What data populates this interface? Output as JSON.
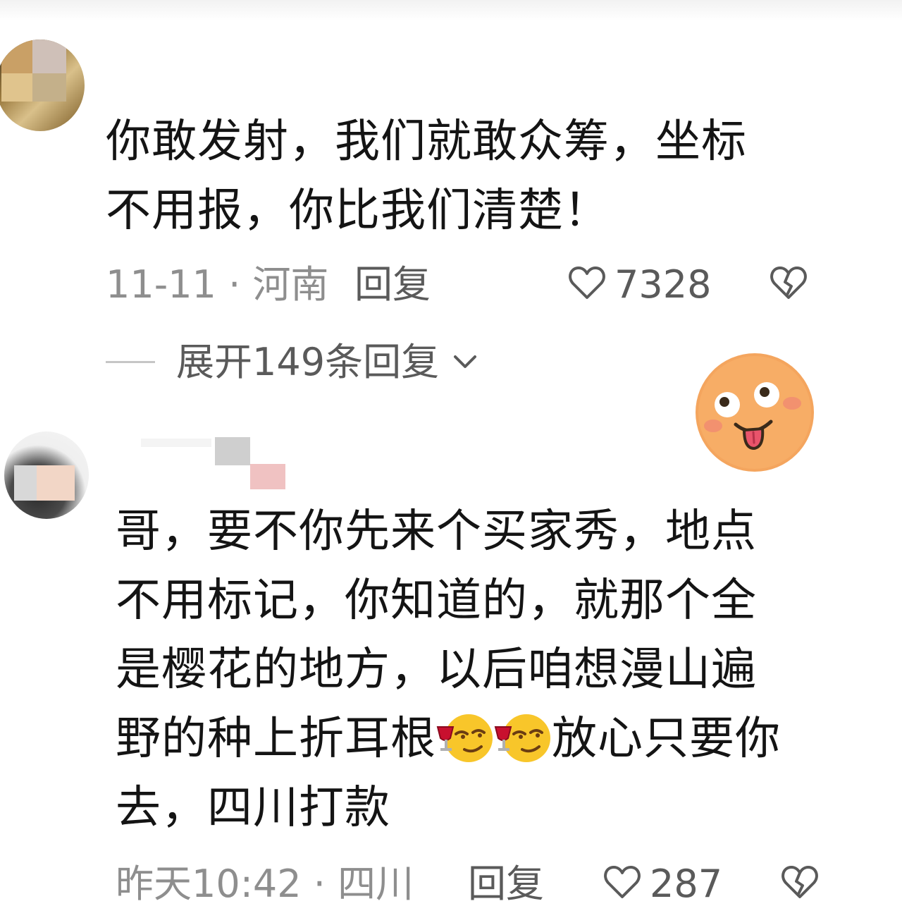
{
  "comments": [
    {
      "text_line1": "你敢发射，我们就敢众筹，坐标",
      "text_line2": "不用报，你比我们清楚！",
      "date": "11-11",
      "separator": "·",
      "location": "河南",
      "reply_label": "回复",
      "likes": "7328",
      "expand_replies": "展开149条回复"
    },
    {
      "text_line1": "哥，要不你先来个买家秀，地点",
      "text_line2": "不用标记，你知道的，就那个全",
      "text_line3": "是樱花的地方，以后咱想漫山遍",
      "text_line4a": "野的种上折耳根",
      "text_line4b": "放心只要你",
      "text_line5": "去，四川打款",
      "date": "昨天10:42",
      "separator": "·",
      "location": "四川",
      "reply_label": "回复",
      "likes": "287"
    }
  ],
  "icons": {
    "like": "heart-outline-icon",
    "dislike": "broken-heart-icon",
    "expand": "chevron-down-icon",
    "sticker": "tongue-out-face-sticker",
    "inline_emoji": "toast-wine-emoji"
  }
}
